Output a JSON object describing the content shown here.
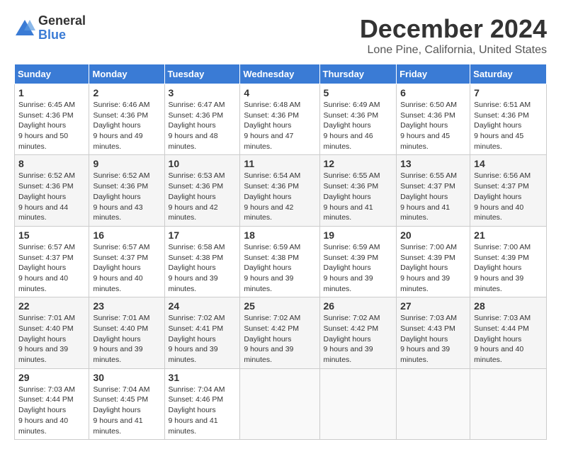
{
  "logo": {
    "general": "General",
    "blue": "Blue"
  },
  "title": "December 2024",
  "location": "Lone Pine, California, United States",
  "days_of_week": [
    "Sunday",
    "Monday",
    "Tuesday",
    "Wednesday",
    "Thursday",
    "Friday",
    "Saturday"
  ],
  "weeks": [
    [
      {
        "day": "1",
        "sunrise": "6:45 AM",
        "sunset": "4:36 PM",
        "daylight": "9 hours and 50 minutes."
      },
      {
        "day": "2",
        "sunrise": "6:46 AM",
        "sunset": "4:36 PM",
        "daylight": "9 hours and 49 minutes."
      },
      {
        "day": "3",
        "sunrise": "6:47 AM",
        "sunset": "4:36 PM",
        "daylight": "9 hours and 48 minutes."
      },
      {
        "day": "4",
        "sunrise": "6:48 AM",
        "sunset": "4:36 PM",
        "daylight": "9 hours and 47 minutes."
      },
      {
        "day": "5",
        "sunrise": "6:49 AM",
        "sunset": "4:36 PM",
        "daylight": "9 hours and 46 minutes."
      },
      {
        "day": "6",
        "sunrise": "6:50 AM",
        "sunset": "4:36 PM",
        "daylight": "9 hours and 45 minutes."
      },
      {
        "day": "7",
        "sunrise": "6:51 AM",
        "sunset": "4:36 PM",
        "daylight": "9 hours and 45 minutes."
      }
    ],
    [
      {
        "day": "8",
        "sunrise": "6:52 AM",
        "sunset": "4:36 PM",
        "daylight": "9 hours and 44 minutes."
      },
      {
        "day": "9",
        "sunrise": "6:52 AM",
        "sunset": "4:36 PM",
        "daylight": "9 hours and 43 minutes."
      },
      {
        "day": "10",
        "sunrise": "6:53 AM",
        "sunset": "4:36 PM",
        "daylight": "9 hours and 42 minutes."
      },
      {
        "day": "11",
        "sunrise": "6:54 AM",
        "sunset": "4:36 PM",
        "daylight": "9 hours and 42 minutes."
      },
      {
        "day": "12",
        "sunrise": "6:55 AM",
        "sunset": "4:36 PM",
        "daylight": "9 hours and 41 minutes."
      },
      {
        "day": "13",
        "sunrise": "6:55 AM",
        "sunset": "4:37 PM",
        "daylight": "9 hours and 41 minutes."
      },
      {
        "day": "14",
        "sunrise": "6:56 AM",
        "sunset": "4:37 PM",
        "daylight": "9 hours and 40 minutes."
      }
    ],
    [
      {
        "day": "15",
        "sunrise": "6:57 AM",
        "sunset": "4:37 PM",
        "daylight": "9 hours and 40 minutes."
      },
      {
        "day": "16",
        "sunrise": "6:57 AM",
        "sunset": "4:37 PM",
        "daylight": "9 hours and 40 minutes."
      },
      {
        "day": "17",
        "sunrise": "6:58 AM",
        "sunset": "4:38 PM",
        "daylight": "9 hours and 39 minutes."
      },
      {
        "day": "18",
        "sunrise": "6:59 AM",
        "sunset": "4:38 PM",
        "daylight": "9 hours and 39 minutes."
      },
      {
        "day": "19",
        "sunrise": "6:59 AM",
        "sunset": "4:39 PM",
        "daylight": "9 hours and 39 minutes."
      },
      {
        "day": "20",
        "sunrise": "7:00 AM",
        "sunset": "4:39 PM",
        "daylight": "9 hours and 39 minutes."
      },
      {
        "day": "21",
        "sunrise": "7:00 AM",
        "sunset": "4:39 PM",
        "daylight": "9 hours and 39 minutes."
      }
    ],
    [
      {
        "day": "22",
        "sunrise": "7:01 AM",
        "sunset": "4:40 PM",
        "daylight": "9 hours and 39 minutes."
      },
      {
        "day": "23",
        "sunrise": "7:01 AM",
        "sunset": "4:40 PM",
        "daylight": "9 hours and 39 minutes."
      },
      {
        "day": "24",
        "sunrise": "7:02 AM",
        "sunset": "4:41 PM",
        "daylight": "9 hours and 39 minutes."
      },
      {
        "day": "25",
        "sunrise": "7:02 AM",
        "sunset": "4:42 PM",
        "daylight": "9 hours and 39 minutes."
      },
      {
        "day": "26",
        "sunrise": "7:02 AM",
        "sunset": "4:42 PM",
        "daylight": "9 hours and 39 minutes."
      },
      {
        "day": "27",
        "sunrise": "7:03 AM",
        "sunset": "4:43 PM",
        "daylight": "9 hours and 39 minutes."
      },
      {
        "day": "28",
        "sunrise": "7:03 AM",
        "sunset": "4:44 PM",
        "daylight": "9 hours and 40 minutes."
      }
    ],
    [
      {
        "day": "29",
        "sunrise": "7:03 AM",
        "sunset": "4:44 PM",
        "daylight": "9 hours and 40 minutes."
      },
      {
        "day": "30",
        "sunrise": "7:04 AM",
        "sunset": "4:45 PM",
        "daylight": "9 hours and 41 minutes."
      },
      {
        "day": "31",
        "sunrise": "7:04 AM",
        "sunset": "4:46 PM",
        "daylight": "9 hours and 41 minutes."
      },
      null,
      null,
      null,
      null
    ]
  ],
  "labels": {
    "sunrise": "Sunrise:",
    "sunset": "Sunset:",
    "daylight": "Daylight hours"
  }
}
